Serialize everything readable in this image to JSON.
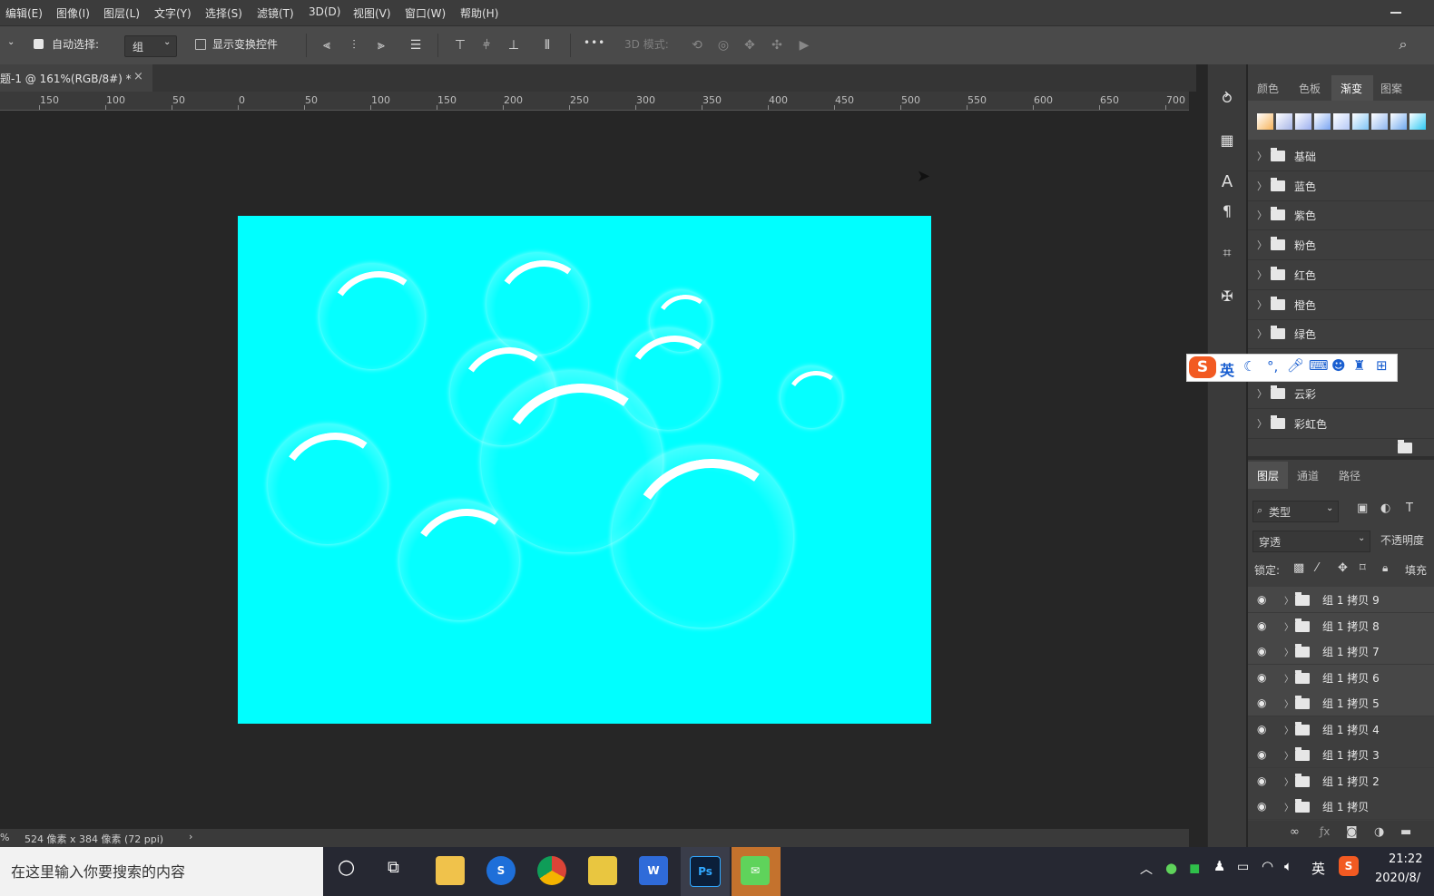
{
  "menu": [
    "编辑(E)",
    "图像(I)",
    "图层(L)",
    "文字(Y)",
    "选择(S)",
    "滤镜(T)",
    "3D(D)",
    "视图(V)",
    "窗口(W)",
    "帮助(H)"
  ],
  "options": {
    "auto_select_label": "自动选择:",
    "auto_select_value": "组",
    "show_transform_label": "显示变换控件",
    "more": "•••",
    "mode_3d_label": "3D 模式:"
  },
  "document_tab": {
    "title": "题-1 @ 161%(RGB/8#) *",
    "close": "×"
  },
  "ruler_labels": [
    "150",
    "100",
    "50",
    "0",
    "50",
    "100",
    "150",
    "200",
    "250",
    "300",
    "350",
    "400",
    "450",
    "500",
    "550",
    "600",
    "650",
    "700"
  ],
  "status": {
    "zoom_fragment": "%",
    "doc_size": "524 像素 x 384 像素 (72 ppi)",
    "arrow": "›"
  },
  "panel_tabs_top": [
    "颜色",
    "色板",
    "渐变",
    "图案"
  ],
  "gradient_swatch_colors": [
    "#f7b45b",
    "#a7b6e8",
    "#9cb0f0",
    "#7aa5f2",
    "#b5c9f7",
    "#7fc4f5",
    "#8db5ef",
    "#6fa9f0",
    "#2ec9f5"
  ],
  "gradient_folders": [
    "基础",
    "蓝色",
    "紫色",
    "粉色",
    "红色",
    "橙色",
    "绿色",
    "云彩",
    "彩虹色"
  ],
  "layers_tabs": [
    "图层",
    "通道",
    "路径"
  ],
  "layers": {
    "filter_label": "类型",
    "blend_mode": "穿透",
    "opacity_label": "不透明度",
    "lock_label": "锁定:",
    "fill_label": "填充",
    "items": [
      "组 1 拷贝 9",
      "组 1 拷贝 8",
      "组 1 拷贝 7",
      "组 1 拷贝 6",
      "组 1 拷贝 5",
      "组 1 拷贝 4",
      "组 1 拷贝 3",
      "组 1 拷贝 2",
      "组 1 拷贝"
    ]
  },
  "ime": {
    "lang": "英"
  },
  "taskbar": {
    "search_placeholder": "在这里输入你要搜索的内容",
    "tray_lang": "英",
    "time": "21:22",
    "date": "2020/8/"
  },
  "colors": {
    "canvas": "#00ffff",
    "workspace": "#262626",
    "panel": "#3e3e3e"
  }
}
